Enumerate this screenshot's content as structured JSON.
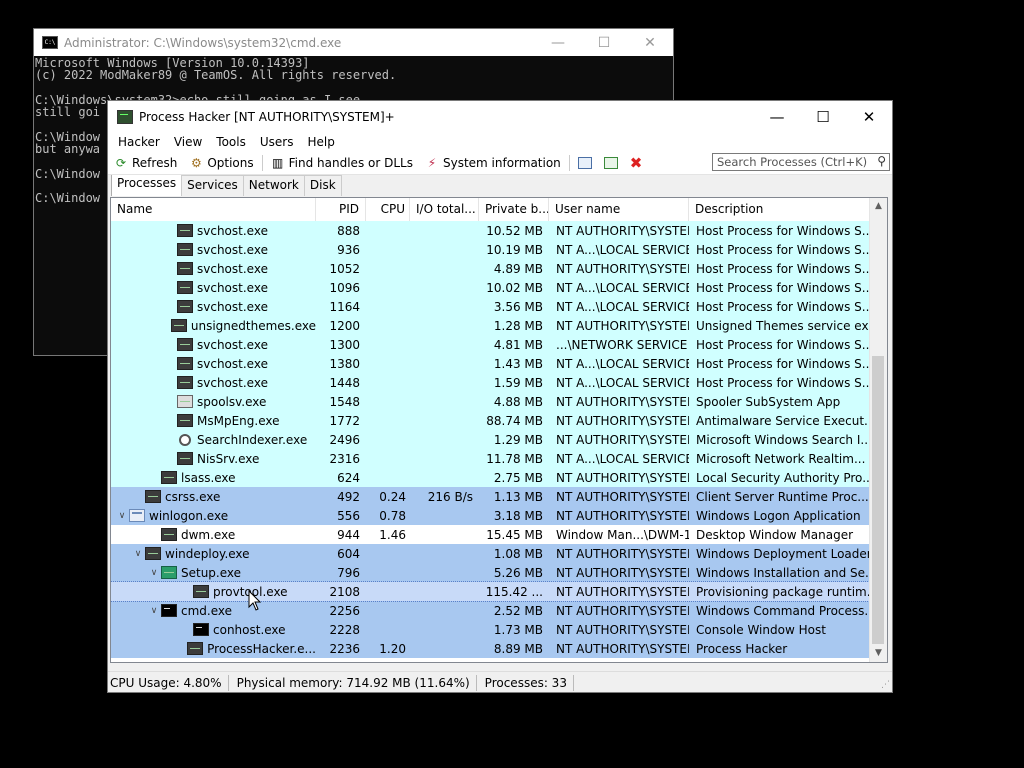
{
  "cmd": {
    "title": "Administrator: C:\\Windows\\system32\\cmd.exe",
    "lines": [
      "Microsoft Windows [Version 10.0.14393]",
      "(c) 2022 ModMaker89 @ TeamOS. All rights reserved.",
      "",
      "C:\\Windows\\system32>echo still going as I see",
      "still goi",
      "",
      "C:\\Window",
      "but anywa",
      "",
      "C:\\Window",
      "",
      "C:\\Window"
    ]
  },
  "ph": {
    "title": "Process Hacker [NT AUTHORITY\\SYSTEM]+",
    "menu": [
      "Hacker",
      "View",
      "Tools",
      "Users",
      "Help"
    ],
    "toolbar": {
      "refresh": "Refresh",
      "options": "Options",
      "find_handles": "Find handles or DLLs",
      "system_info": "System information"
    },
    "search_placeholder": "Search Processes (Ctrl+K)",
    "tabs": [
      "Processes",
      "Services",
      "Network",
      "Disk"
    ],
    "columns": [
      "Name",
      "PID",
      "CPU",
      "I/O total...",
      "Private b...",
      "User name",
      "Description"
    ],
    "status": {
      "cpu": "CPU Usage: 4.80%",
      "memory": "Physical memory: 714.92 MB (11.64%)",
      "processes": "Processes: 33"
    }
  },
  "colors": {
    "service_row": "#d0ffff",
    "system_row": "#a8c8f0",
    "selected_row": "#c8daf8"
  },
  "rows": [
    {
      "name": "svchost.exe",
      "pid": "888",
      "cpu": "",
      "io": "",
      "priv": "10.52 MB",
      "user": "NT AUTHORITY\\SYSTEM",
      "desc": "Host Process for Windows S...",
      "indent": 3,
      "tw": "",
      "icon": "svc",
      "bg": "service"
    },
    {
      "name": "svchost.exe",
      "pid": "936",
      "cpu": "",
      "io": "",
      "priv": "10.19 MB",
      "user": "NT A...\\LOCAL SERVICE",
      "desc": "Host Process for Windows S...",
      "indent": 3,
      "tw": "",
      "icon": "svc",
      "bg": "service"
    },
    {
      "name": "svchost.exe",
      "pid": "1052",
      "cpu": "",
      "io": "",
      "priv": "4.89 MB",
      "user": "NT AUTHORITY\\SYSTEM",
      "desc": "Host Process for Windows S...",
      "indent": 3,
      "tw": "",
      "icon": "svc",
      "bg": "service"
    },
    {
      "name": "svchost.exe",
      "pid": "1096",
      "cpu": "",
      "io": "",
      "priv": "10.02 MB",
      "user": "NT A...\\LOCAL SERVICE",
      "desc": "Host Process for Windows S...",
      "indent": 3,
      "tw": "",
      "icon": "svc",
      "bg": "service"
    },
    {
      "name": "svchost.exe",
      "pid": "1164",
      "cpu": "",
      "io": "",
      "priv": "3.56 MB",
      "user": "NT A...\\LOCAL SERVICE",
      "desc": "Host Process for Windows S...",
      "indent": 3,
      "tw": "",
      "icon": "svc",
      "bg": "service"
    },
    {
      "name": "unsignedthemes.exe",
      "pid": "1200",
      "cpu": "",
      "io": "",
      "priv": "1.28 MB",
      "user": "NT AUTHORITY\\SYSTEM",
      "desc": "Unsigned Themes service ex...",
      "indent": 3,
      "tw": "",
      "icon": "svc",
      "bg": "service"
    },
    {
      "name": "svchost.exe",
      "pid": "1300",
      "cpu": "",
      "io": "",
      "priv": "4.81 MB",
      "user": "...\\NETWORK SERVICE",
      "desc": "Host Process for Windows S...",
      "indent": 3,
      "tw": "",
      "icon": "svc",
      "bg": "service"
    },
    {
      "name": "svchost.exe",
      "pid": "1380",
      "cpu": "",
      "io": "",
      "priv": "1.43 MB",
      "user": "NT A...\\LOCAL SERVICE",
      "desc": "Host Process for Windows S...",
      "indent": 3,
      "tw": "",
      "icon": "svc",
      "bg": "service"
    },
    {
      "name": "svchost.exe",
      "pid": "1448",
      "cpu": "",
      "io": "",
      "priv": "1.59 MB",
      "user": "NT A...\\LOCAL SERVICE",
      "desc": "Host Process for Windows S...",
      "indent": 3,
      "tw": "",
      "icon": "svc",
      "bg": "service"
    },
    {
      "name": "spoolsv.exe",
      "pid": "1548",
      "cpu": "",
      "io": "",
      "priv": "4.88 MB",
      "user": "NT AUTHORITY\\SYSTEM",
      "desc": "Spooler SubSystem App",
      "indent": 3,
      "tw": "",
      "icon": "prn",
      "bg": "service"
    },
    {
      "name": "MsMpEng.exe",
      "pid": "1772",
      "cpu": "",
      "io": "",
      "priv": "88.74 MB",
      "user": "NT AUTHORITY\\SYSTEM",
      "desc": "Antimalware Service Execut...",
      "indent": 3,
      "tw": "",
      "icon": "svc",
      "bg": "service"
    },
    {
      "name": "SearchIndexer.exe",
      "pid": "2496",
      "cpu": "",
      "io": "",
      "priv": "1.29 MB",
      "user": "NT AUTHORITY\\SYSTEM",
      "desc": "Microsoft Windows Search I...",
      "indent": 3,
      "tw": "",
      "icon": "srch",
      "bg": "service"
    },
    {
      "name": "NisSrv.exe",
      "pid": "2316",
      "cpu": "",
      "io": "",
      "priv": "11.78 MB",
      "user": "NT A...\\LOCAL SERVICE",
      "desc": "Microsoft Network Realtim...",
      "indent": 3,
      "tw": "",
      "icon": "svc",
      "bg": "service"
    },
    {
      "name": "lsass.exe",
      "pid": "624",
      "cpu": "",
      "io": "",
      "priv": "2.75 MB",
      "user": "NT AUTHORITY\\SYSTEM",
      "desc": "Local Security Authority Pro...",
      "indent": 2,
      "tw": "",
      "icon": "svc",
      "bg": "service"
    },
    {
      "name": "csrss.exe",
      "pid": "492",
      "cpu": "0.24",
      "io": "216 B/s",
      "priv": "1.13 MB",
      "user": "NT AUTHORITY\\SYSTEM",
      "desc": "Client Server Runtime Proc...",
      "indent": 1,
      "tw": "",
      "icon": "svc",
      "bg": "system"
    },
    {
      "name": "winlogon.exe",
      "pid": "556",
      "cpu": "0.78",
      "io": "",
      "priv": "3.18 MB",
      "user": "NT AUTHORITY\\SYSTEM",
      "desc": "Windows Logon Application",
      "indent": 0,
      "tw": "∨",
      "icon": "win",
      "bg": "system"
    },
    {
      "name": "dwm.exe",
      "pid": "944",
      "cpu": "1.46",
      "io": "",
      "priv": "15.45 MB",
      "user": "Window Man...\\DWM-1",
      "desc": "Desktop Window Manager",
      "indent": 2,
      "tw": "",
      "icon": "svc",
      "bg": "none"
    },
    {
      "name": "windeploy.exe",
      "pid": "604",
      "cpu": "",
      "io": "",
      "priv": "1.08 MB",
      "user": "NT AUTHORITY\\SYSTEM",
      "desc": "Windows Deployment Loader",
      "indent": 1,
      "tw": "∨",
      "icon": "svc",
      "bg": "system"
    },
    {
      "name": "Setup.exe",
      "pid": "796",
      "cpu": "",
      "io": "",
      "priv": "5.26 MB",
      "user": "NT AUTHORITY\\SYSTEM",
      "desc": "Windows Installation and Se...",
      "indent": 2,
      "tw": "∨",
      "icon": "setup",
      "bg": "system"
    },
    {
      "name": "provtool.exe",
      "pid": "2108",
      "cpu": "",
      "io": "",
      "priv": "115.42 ...",
      "user": "NT AUTHORITY\\SYSTEM",
      "desc": "Provisioning package runtim...",
      "indent": 4,
      "tw": "",
      "icon": "svc",
      "bg": "selected"
    },
    {
      "name": "cmd.exe",
      "pid": "2256",
      "cpu": "",
      "io": "",
      "priv": "2.52 MB",
      "user": "NT AUTHORITY\\SYSTEM",
      "desc": "Windows Command Process...",
      "indent": 2,
      "tw": "∨",
      "icon": "cmdi",
      "bg": "system"
    },
    {
      "name": "conhost.exe",
      "pid": "2228",
      "cpu": "",
      "io": "",
      "priv": "1.73 MB",
      "user": "NT AUTHORITY\\SYSTEM",
      "desc": "Console Window Host",
      "indent": 4,
      "tw": "",
      "icon": "cmdi",
      "bg": "system"
    },
    {
      "name": "ProcessHacker.e...",
      "pid": "2236",
      "cpu": "1.20",
      "io": "",
      "priv": "8.89 MB",
      "user": "NT AUTHORITY\\SYSTEM",
      "desc": "Process Hacker",
      "indent": 4,
      "tw": "",
      "icon": "svc",
      "bg": "system"
    }
  ]
}
